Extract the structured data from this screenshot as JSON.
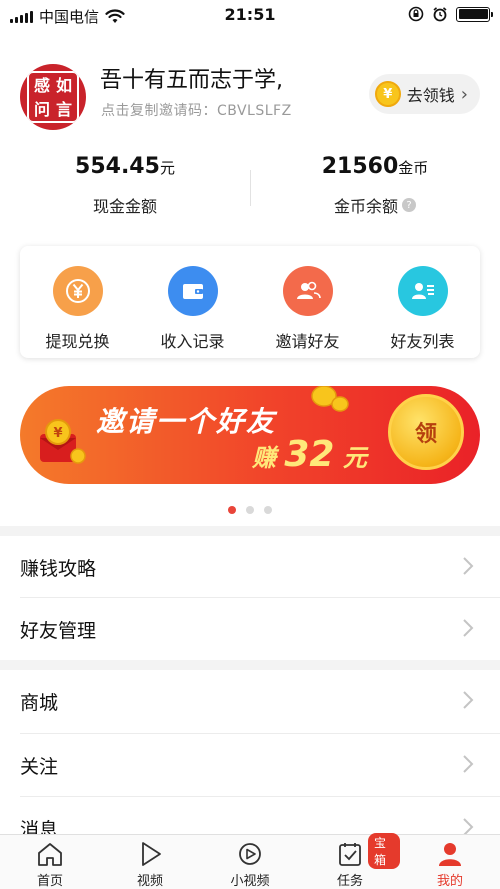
{
  "status_bar": {
    "carrier": "中国电信",
    "time": "21:51"
  },
  "profile": {
    "avatar_text": [
      "感",
      "如",
      "问",
      "言"
    ],
    "username": "吾十有五而志于学,",
    "invite_code": "点击复制邀请码：CBVLSLFZ",
    "earn_button_label": "去领钱",
    "earn_button_icon": "yuan-coin-icon"
  },
  "stats": {
    "cash": {
      "value": "554.45",
      "unit": "元",
      "label": "现金金额"
    },
    "coins": {
      "value": "21560",
      "unit": "金币",
      "label": "金币余额"
    }
  },
  "actions": [
    {
      "label": "提现兑换",
      "icon": "yuan-exchange-icon",
      "color": "#f7a04a"
    },
    {
      "label": "收入记录",
      "icon": "wallet-icon",
      "color": "#3d8df0"
    },
    {
      "label": "邀请好友",
      "icon": "people-icon",
      "color": "#f36a4b"
    },
    {
      "label": "好友列表",
      "icon": "contact-list-icon",
      "color": "#28c7e0"
    }
  ],
  "banner": {
    "title": "邀请一个好友",
    "earn_prefix": "赚",
    "earn_amount": "32",
    "earn_unit": "元",
    "collect_label": "领",
    "colors": [
      "#f47a2a",
      "#ea2228"
    ]
  },
  "carousel": {
    "pages": 3,
    "active": 1
  },
  "menu_group_1": [
    "赚钱攻略",
    "好友管理"
  ],
  "menu_group_2": [
    "商城",
    "关注",
    "消息"
  ],
  "tabs": [
    {
      "label": "首页",
      "icon": "home-icon"
    },
    {
      "label": "视频",
      "icon": "play-icon"
    },
    {
      "label": "小视频",
      "icon": "small-video-icon"
    },
    {
      "label": "任务",
      "icon": "task-icon",
      "badge": "宝箱"
    },
    {
      "label": "我的",
      "icon": "profile-icon",
      "active": true
    }
  ],
  "colors": {
    "accent": "#e53a2c",
    "coin_gold": "#f8c51c"
  }
}
